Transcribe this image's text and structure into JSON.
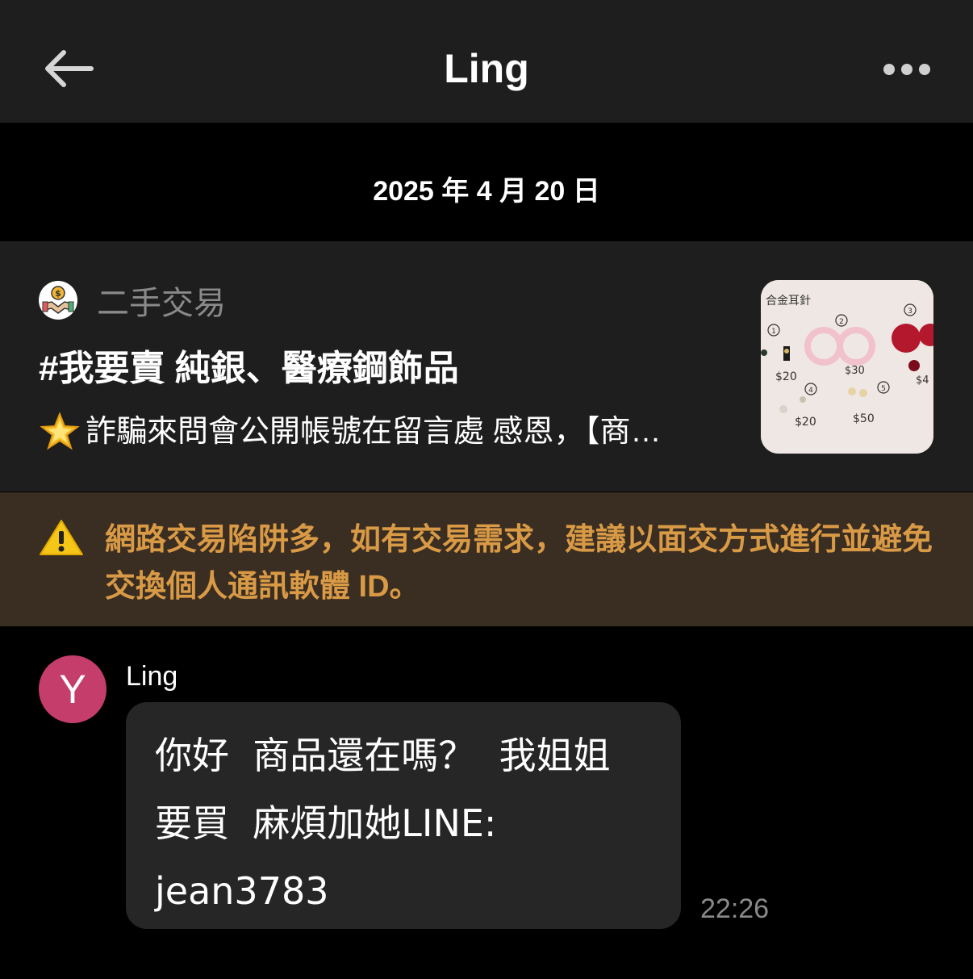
{
  "header": {
    "title": "Ling"
  },
  "date_separator": "2025 年 4 月 20 日",
  "listing": {
    "group_name": "二手交易",
    "title": "#我要賣 純銀、醫療鋼飾品",
    "preview": "詐騙來問會公開帳號在留言處 感恩，【商…",
    "thumbnail": {
      "label": "合金耳針",
      "items": [
        {
          "num": "1",
          "price": "$20"
        },
        {
          "num": "2",
          "price": "$30"
        },
        {
          "num": "3",
          "price": "$4"
        },
        {
          "num": "4",
          "price": "$20"
        },
        {
          "num": "5",
          "price": "$50"
        }
      ]
    }
  },
  "warning": {
    "text": "網路交易陷阱多，如有交易需求，建議以面交方式進行並避免交換個人通訊軟體 ID。"
  },
  "message": {
    "avatar_letter": "Y",
    "sender": "Ling",
    "text": "你好  商品還在嗎？  我姐姐\n要買  麻煩加她LINE:\njean3783",
    "time": "22:26"
  },
  "colors": {
    "header_bg": "#1e1e1e",
    "warning_bg": "#3a2d22",
    "warning_text": "#d99a46",
    "avatar_bg": "#c43d6b",
    "bubble_bg": "#262626"
  }
}
